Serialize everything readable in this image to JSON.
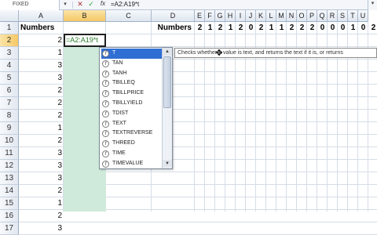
{
  "formula_bar": {
    "name_box": "FIXED",
    "name_box_arrow": "▾",
    "cancel": "✕",
    "enter": "✓",
    "fx": "fx",
    "formula": "=A2:A19*t",
    "right_arrow": "▾"
  },
  "columns": [
    "A",
    "B",
    "C",
    "D",
    "E",
    "F",
    "G",
    "H",
    "I",
    "J",
    "K",
    "L",
    "M",
    "N",
    "O",
    "P",
    "Q",
    "R",
    "S",
    "T",
    "U"
  ],
  "selected_column": "B",
  "rows": [
    "1",
    "2",
    "3",
    "4",
    "5",
    "6",
    "7",
    "8",
    "9",
    "10",
    "11",
    "12",
    "13",
    "14",
    "15",
    "16",
    "17"
  ],
  "selected_row": "2",
  "cells": {
    "a1": "Numbers",
    "d1": "Numbers",
    "col_a_values": [
      "2",
      "1",
      "3",
      "3",
      "2",
      "2",
      "2",
      "1",
      "2",
      "3",
      "3",
      "3",
      "2",
      "1",
      "2",
      "3"
    ],
    "row1_values": [
      "2",
      "1",
      "2",
      "1",
      "2",
      "0",
      "2",
      "1",
      "1",
      "2",
      "2",
      "2",
      "0",
      "0",
      "0",
      "1",
      "0",
      "2"
    ],
    "b2_edit": "=A2:A19*t"
  },
  "autocomplete": {
    "items": [
      "T",
      "TAN",
      "TANH",
      "TBILLEQ",
      "TBILLPRICE",
      "TBILLYIELD",
      "TDIST",
      "TEXT",
      "TEXTREVERSE",
      "THREED",
      "TIME",
      "TIMEVALUE"
    ],
    "highlighted_index": 0,
    "item_icon": "function-icon",
    "scroll_up": "▲",
    "scroll_down": "▼"
  },
  "tooltip": "Checks whether a value is text, and returns the text if it is, or returns",
  "cursor_icon": "move-cursor-icon",
  "colors": {
    "selection_header": "#f6c865",
    "column_b_fill": "#cfeadb",
    "highlight": "#2f6fd3"
  }
}
